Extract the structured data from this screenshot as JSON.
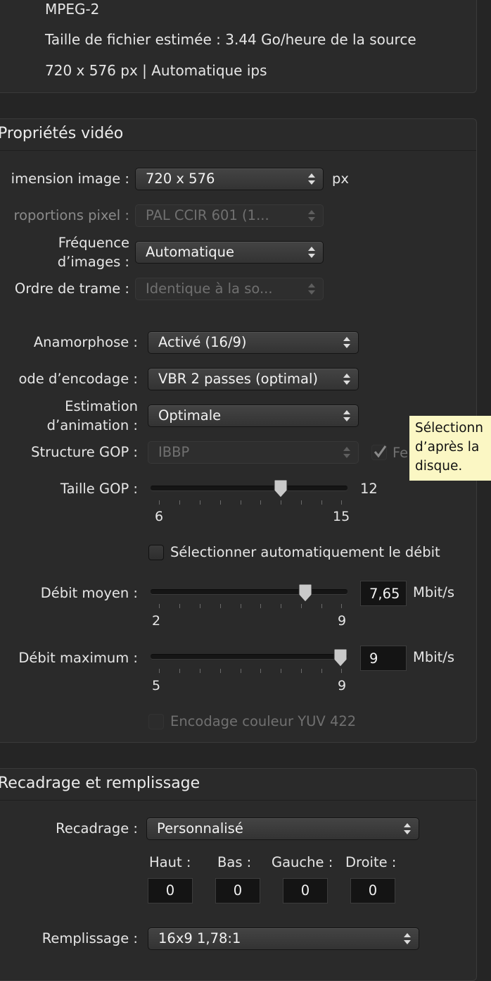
{
  "summary": {
    "format": "MPEG-2",
    "file_size": "Taille de fichier estimée : 3.44 Go/heure de la source",
    "resolution": "720 x 576 px | Automatique ips"
  },
  "video": {
    "title": "Propriétés vidéo",
    "dimension_label": "imension image :",
    "dimension_value": "720 x 576",
    "dimension_unit": "px",
    "pixel_label": "roportions pixel :",
    "pixel_value": "PAL CCIR 601 (1...",
    "frame_rate_label_1": "Fréquence",
    "frame_rate_label_2": "d’images :",
    "frame_rate_value": "Automatique",
    "field_order_label": "Ordre de trame :",
    "field_order_value": "Identique à la so...",
    "anamorphic_label": "Anamorphose :",
    "anamorphic_value": "Activé (16/9)",
    "encoding_label": "ode d’encodage :",
    "encoding_value": "VBR 2 passes (optimal)",
    "motion_label_1": "Estimation",
    "motion_label_2": "d’animation :",
    "motion_value": "Optimale",
    "gop_structure_label": "Structure GOP :",
    "gop_structure_value": "IBBP",
    "gop_closed_label": "Fe",
    "gop_size_label": "Taille GOP :",
    "gop_size_value": "12",
    "gop_size_min": "6",
    "gop_size_max": "15",
    "gop_size_level": 0.67,
    "auto_bitrate_label": "Sélectionner automatiquement le débit",
    "avg_bitrate_label": "Débit moyen :",
    "avg_bitrate_value": "7,65",
    "avg_bitrate_unit": "Mbit/s",
    "avg_bitrate_min": "2",
    "avg_bitrate_max": "9",
    "avg_bitrate_level": 0.807,
    "max_bitrate_label": "Débit maximum :",
    "max_bitrate_value": "9",
    "max_bitrate_unit": "Mbit/s",
    "max_bitrate_min": "5",
    "max_bitrate_max": "9",
    "max_bitrate_level": 1.0,
    "yuv_label": "Encodage couleur YUV 422"
  },
  "tooltip": {
    "line1": "Sélectionn",
    "line2": "d’après la",
    "line3": "disque."
  },
  "crop": {
    "title": "Recadrage et remplissage",
    "crop_label": "Recadrage :",
    "crop_value": "Personnalisé",
    "top_label": "Haut :",
    "bottom_label": "Bas :",
    "left_label": "Gauche :",
    "right_label": "Droite :",
    "top_value": "0",
    "bottom_value": "0",
    "left_value": "0",
    "right_value": "0",
    "padding_label": "Remplissage :",
    "padding_value": "16x9 1,78:1"
  }
}
